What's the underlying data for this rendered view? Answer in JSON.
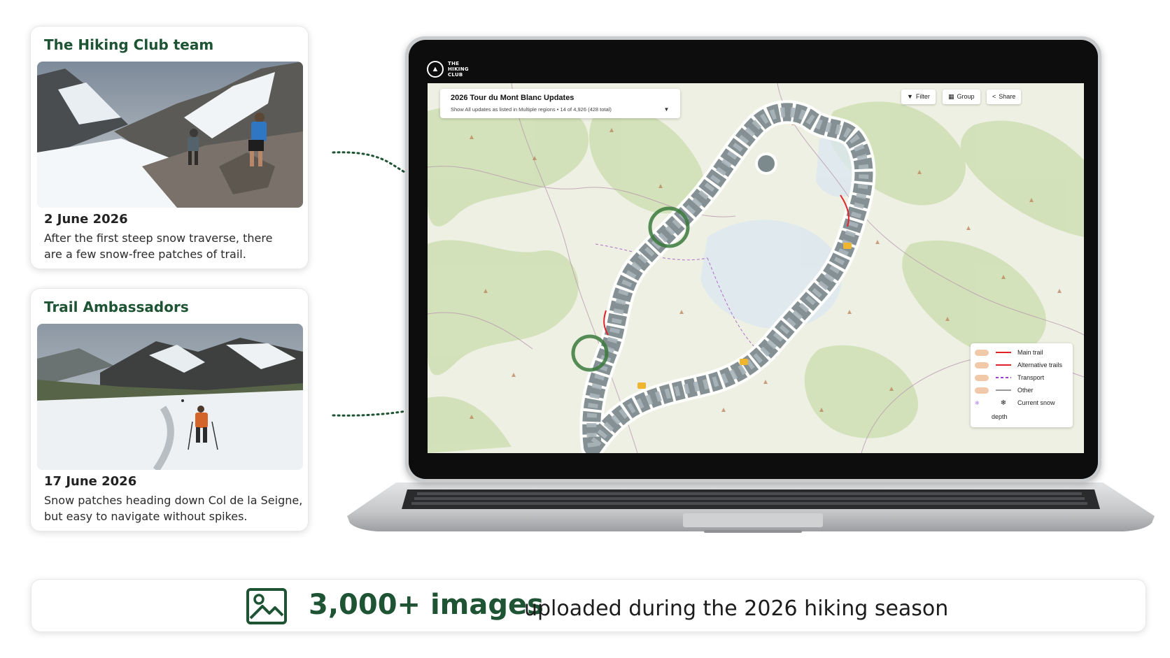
{
  "cards": [
    {
      "title": "The Hiking Club team",
      "date": "2 June 2026",
      "text": "After the first steep snow traverse, there are a few snow-free patches of trail."
    },
    {
      "title": "Trail Ambassadors",
      "date": "17 June 2026",
      "text": "Snow patches heading down Col de la Seigne, but easy to navigate without spikes."
    }
  ],
  "brand": {
    "line1": "THE",
    "line2": "HIKING",
    "line3": "CLUB"
  },
  "map": {
    "title": "2026 Tour du Mont Blanc Updates",
    "subtitle": "Show All updates as listed in Multiple regions • 14 of 4,926 (428 total)",
    "toolbar": {
      "filter": "Filter",
      "group": "Group",
      "share": "Share"
    },
    "legend": {
      "main_trail": "Main trail",
      "alternative_trails": "Alternative trails",
      "transport": "Transport",
      "other": "Other",
      "current_snow": "Current snow",
      "depth": "depth"
    }
  },
  "banner": {
    "headline": "3,000+ images",
    "tagline": "uploaded during the 2026 hiking season"
  },
  "colors": {
    "brand_green": "#1e5434",
    "main_trail": "#e0232a",
    "alternative_trails": "#e0232a",
    "transport": "#a13ad6",
    "other": "#9a9a9a"
  }
}
